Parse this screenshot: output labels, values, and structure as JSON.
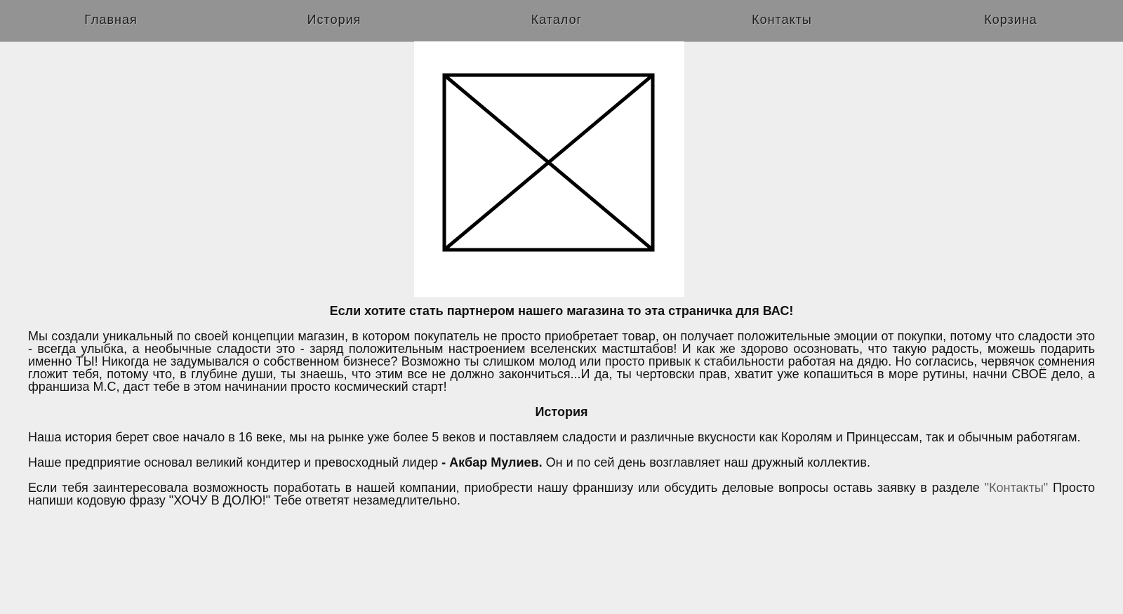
{
  "nav": {
    "items": [
      {
        "label": "Главная"
      },
      {
        "label": "История"
      },
      {
        "label": "Каталог"
      },
      {
        "label": "Контакты"
      },
      {
        "label": "Корзина"
      }
    ]
  },
  "hero": {
    "icon": "image-placeholder-icon"
  },
  "content": {
    "headline": "Если хотите стать партнером нашего магазина то эта страничка для ВАС!",
    "intro": "Мы создали уникальный по своей концепции магазин, в котором покупатель не просто приобретает товар, он получает положительные эмоции от покупки, потому что сладости это - всегда улыбка, а необычные сладости это - заряд положительным настроением вселенских мастштабов! И как же здорово осозновать, что такую радость, можешь подарить именно ТЫ! Никогда не задумывался о собственном бизнесе? Возможно ты слишком молод или просто привык к стабильности работая на дядю. Но согласись, червячок сомнения гложит тебя, потому что, в глубине души, ты знаешь, что этим все не должно закончиться...И да, ты чертовски прав, хватит уже копашиться в море рутины, начни СВОЁ дело, а франшиза М.С, даст тебе в этом начинании просто космический старт!",
    "history_title": "История",
    "history_text": "Наша история берет свое начало в 16 веке, мы на рынке уже более 5 веков и поставляем сладости и различные вкусности как Королям и Принцессам, так и обычным работягам.",
    "founder_prefix": "Наше предприятие основал великий кондитер и превосходный лидер ",
    "founder_name": "- Акбар Мулиев.",
    "founder_suffix": " Он и по сей день возглавляет наш дружный коллектив.",
    "contact_prefix": "Если тебя заинтересовала возможность поработать в нашей компании, приобрести нашу франшизу или обсудить деловые вопросы оставь заявку в разделе ",
    "contact_link": "\"Контакты\"",
    "contact_suffix": " Просто напиши кодовую фразу \"ХОЧУ В ДОЛЮ!\" Тебе ответят незамедлительно."
  },
  "colors": {
    "nav_bg": "#939393",
    "page_bg": "#eeeeee",
    "link": "#606060"
  }
}
